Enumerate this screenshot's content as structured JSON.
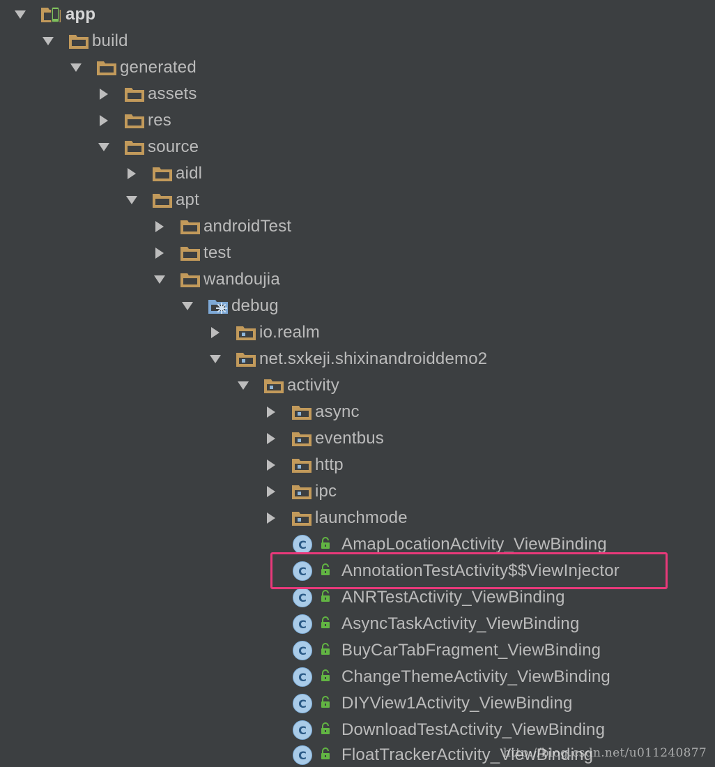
{
  "colors": {
    "background": "#3c3f41",
    "text": "#bbbbbb",
    "folder": "#c29a5b",
    "package_dot": "#8fb5d8",
    "class_circle": "#a9cbe8",
    "lock": "#62b543",
    "highlight_border": "#e8397a"
  },
  "tree": {
    "items": [
      {
        "label": "app",
        "expanded": true,
        "icon": "module-icon"
      },
      {
        "label": "build",
        "expanded": true,
        "icon": "folder-icon"
      },
      {
        "label": "generated",
        "expanded": true,
        "icon": "folder-icon"
      },
      {
        "label": "assets",
        "expanded": false,
        "icon": "folder-icon"
      },
      {
        "label": "res",
        "expanded": false,
        "icon": "folder-icon"
      },
      {
        "label": "source",
        "expanded": true,
        "icon": "folder-icon"
      },
      {
        "label": "aidl",
        "expanded": false,
        "icon": "folder-icon"
      },
      {
        "label": "apt",
        "expanded": true,
        "icon": "folder-icon"
      },
      {
        "label": "androidTest",
        "expanded": false,
        "icon": "folder-icon"
      },
      {
        "label": "test",
        "expanded": false,
        "icon": "folder-icon"
      },
      {
        "label": "wandoujia",
        "expanded": true,
        "icon": "folder-icon"
      },
      {
        "label": "debug",
        "expanded": true,
        "icon": "source-root-folder-icon"
      },
      {
        "label": "io.realm",
        "expanded": false,
        "icon": "package-folder-icon"
      },
      {
        "label": "net.sxkeji.shixinandroiddemo2",
        "expanded": true,
        "icon": "package-folder-icon"
      },
      {
        "label": "activity",
        "expanded": true,
        "icon": "package-folder-icon"
      },
      {
        "label": "async",
        "expanded": false,
        "icon": "package-folder-icon"
      },
      {
        "label": "eventbus",
        "expanded": false,
        "icon": "package-folder-icon"
      },
      {
        "label": "http",
        "expanded": false,
        "icon": "package-folder-icon"
      },
      {
        "label": "ipc",
        "expanded": false,
        "icon": "package-folder-icon"
      },
      {
        "label": "launchmode",
        "expanded": false,
        "icon": "package-folder-icon"
      },
      {
        "label": "AmapLocationActivity_ViewBinding",
        "icon": "class-icon"
      },
      {
        "label": "AnnotationTestActivity$$ViewInjector",
        "icon": "class-icon",
        "highlighted": true
      },
      {
        "label": "ANRTestActivity_ViewBinding",
        "icon": "class-icon"
      },
      {
        "label": "AsyncTaskActivity_ViewBinding",
        "icon": "class-icon"
      },
      {
        "label": "BuyCarTabFragment_ViewBinding",
        "icon": "class-icon"
      },
      {
        "label": "ChangeThemeActivity_ViewBinding",
        "icon": "class-icon"
      },
      {
        "label": "DIYView1Activity_ViewBinding",
        "icon": "class-icon"
      },
      {
        "label": "DownloadTestActivity_ViewBinding",
        "icon": "class-icon"
      },
      {
        "label": "FloatTrackerActivity_ViewBinding",
        "icon": "class-icon"
      }
    ],
    "class_icon_letter": "C"
  },
  "watermark": "http://blog.csdn.net/u011240877"
}
